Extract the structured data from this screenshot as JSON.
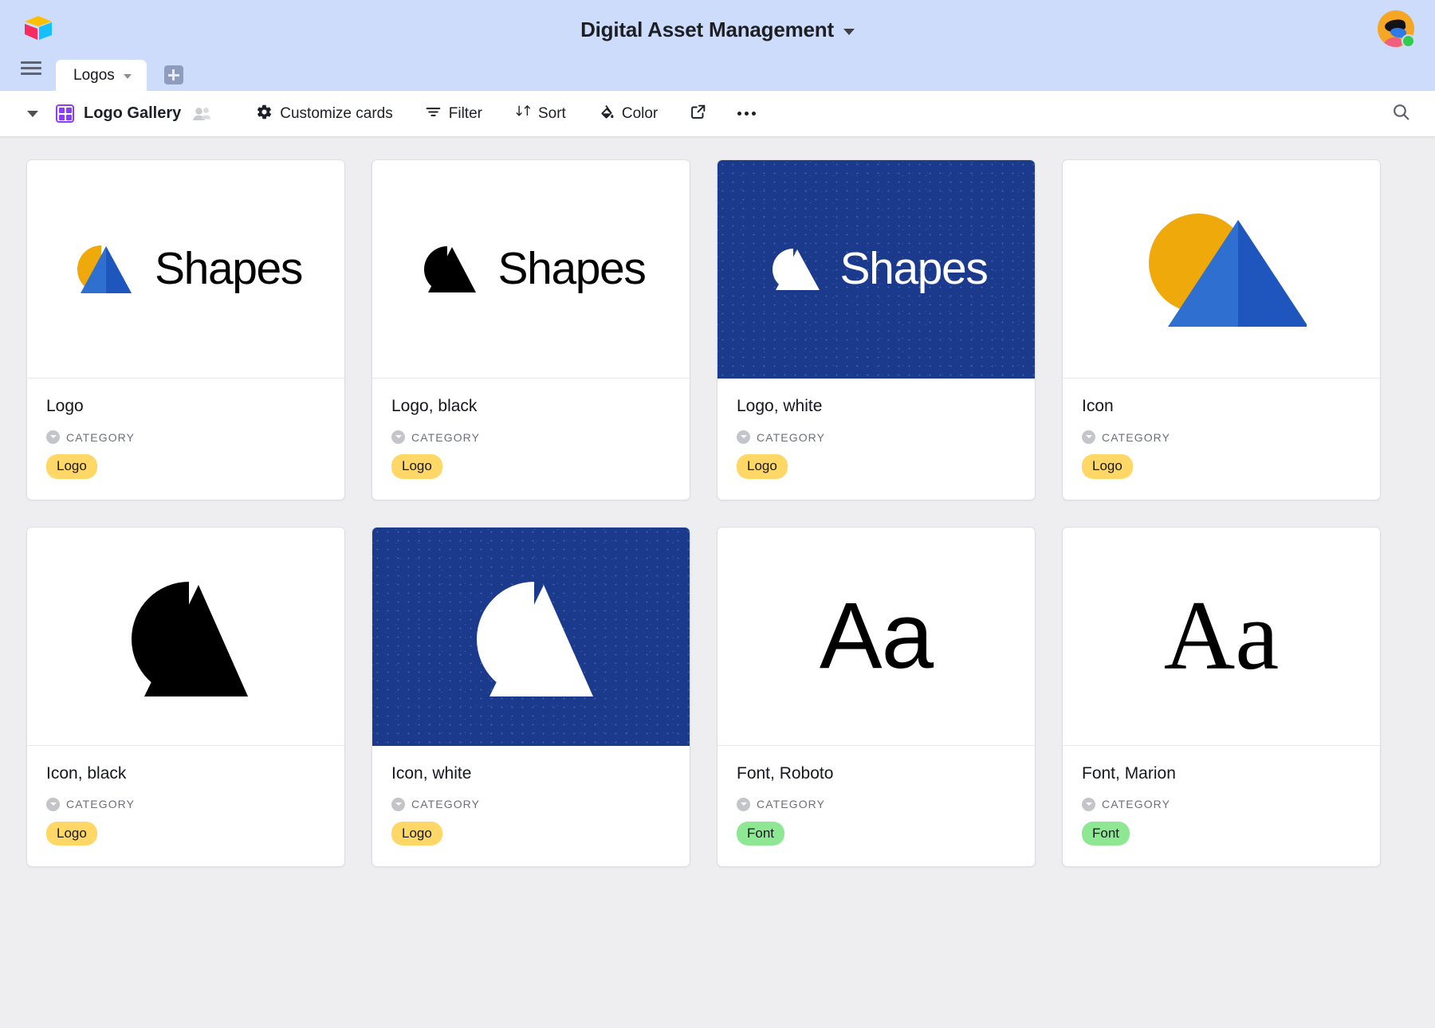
{
  "header": {
    "title": "Digital Asset Management",
    "title_caret": "chevron-down",
    "brand_logo": "airtable-logo",
    "avatar": "user-avatar",
    "status": "online"
  },
  "tabs": {
    "menu_icon": "hamburger-menu-icon",
    "active_tab": "Logos",
    "tab_caret": "chevron-down",
    "add_tab": "add-table-button"
  },
  "toolbar": {
    "collapse_caret": "chevron-down",
    "view_icon": "gallery-grid-icon",
    "view_name": "Logo Gallery",
    "collaborators_icon": "collaborators-icon",
    "buttons": [
      {
        "label": "Customize cards",
        "icon": "gear-icon"
      },
      {
        "label": "Filter",
        "icon": "filter-icon"
      },
      {
        "label": "Sort",
        "icon": "sort-icon"
      },
      {
        "label": "Color",
        "icon": "paint-bucket-icon"
      }
    ],
    "share_icon": "share-export-icon",
    "more_icon": "more-options-icon",
    "search_icon": "search-icon"
  },
  "accent_colors": {
    "header_bg": "#cddcfa",
    "board_bg": "#eeeef0",
    "view_accent": "#8b3dfa",
    "brand_navy": "#1b3a8c",
    "brand_amber": "#f0a90a",
    "brand_blue": "#2f6fd0",
    "badge_logo": "#ffd766",
    "badge_font": "#8ee893"
  },
  "field_label": "CATEGORY",
  "cards": [
    {
      "title": "Logo",
      "category": "Logo",
      "badge_color": "yellow",
      "art": "lockup-color",
      "wordmark": "Shapes",
      "thumb": "light"
    },
    {
      "title": "Logo, black",
      "category": "Logo",
      "badge_color": "yellow",
      "art": "lockup-black",
      "wordmark": "Shapes",
      "thumb": "light"
    },
    {
      "title": "Logo, white",
      "category": "Logo",
      "badge_color": "yellow",
      "art": "lockup-white",
      "wordmark": "Shapes",
      "thumb": "navy"
    },
    {
      "title": "Icon",
      "category": "Logo",
      "badge_color": "yellow",
      "art": "icon-color",
      "wordmark": "",
      "thumb": "light"
    },
    {
      "title": "Icon, black",
      "category": "Logo",
      "badge_color": "yellow",
      "art": "icon-black",
      "wordmark": "",
      "thumb": "light"
    },
    {
      "title": "Icon, white",
      "category": "Logo",
      "badge_color": "yellow",
      "art": "icon-white",
      "wordmark": "",
      "thumb": "navy"
    },
    {
      "title": "Font, Roboto",
      "category": "Font",
      "badge_color": "green",
      "art": "specimen-sans",
      "wordmark": "Aa",
      "thumb": "light"
    },
    {
      "title": "Font, Marion",
      "category": "Font",
      "badge_color": "green",
      "art": "specimen-serif",
      "wordmark": "Aa",
      "thumb": "light"
    }
  ]
}
